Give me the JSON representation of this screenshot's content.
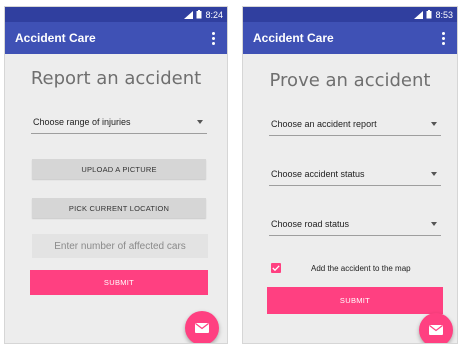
{
  "left_screen": {
    "status_time": "8:24",
    "app_title": "Accident Care",
    "page_title": "Report an accident",
    "injuries_spinner": "Choose range of injuries",
    "upload_button": "UPLOAD A PICTURE",
    "location_button": "PICK CURRENT LOCATION",
    "cars_input_placeholder": "Enter number of affected cars",
    "submit_button": "SUBMIT",
    "fab_icon": "mail-icon"
  },
  "right_screen": {
    "status_time": "8:53",
    "app_title": "Accident Care",
    "page_title": "Prove an accident",
    "report_spinner": "Choose an accident report",
    "status_spinner": "Choose accident status",
    "road_spinner": "Choose road status",
    "map_checkbox_label": "Add the accident to the map",
    "map_checkbox_checked": true,
    "submit_button": "SUBMIT",
    "fab_icon": "mail-icon"
  },
  "colors": {
    "status_bar": "#303f9f",
    "app_bar": "#3f51b5",
    "accent": "#ff4081",
    "background": "#ededed"
  }
}
